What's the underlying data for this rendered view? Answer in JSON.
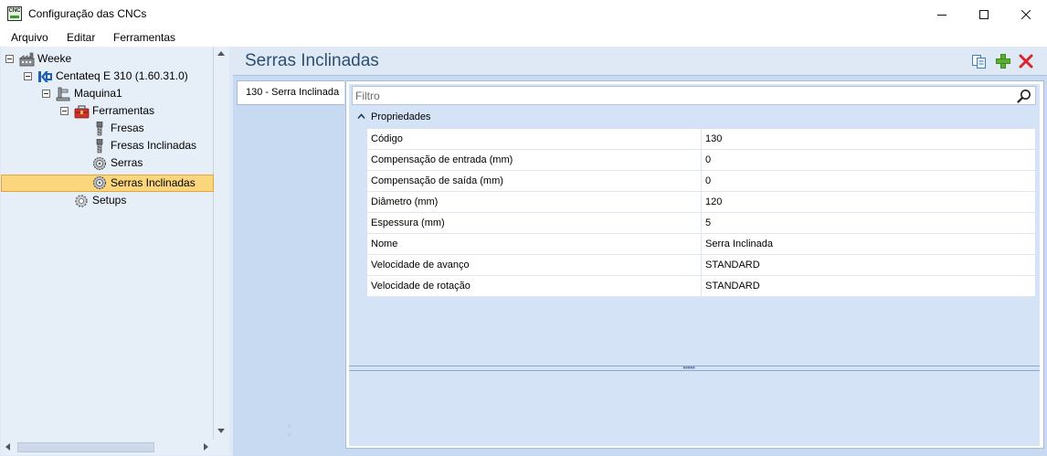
{
  "window": {
    "title": "Configuração das CNCs",
    "app_icon_text": "CNC",
    "controls": [
      "minimize",
      "maximize",
      "close"
    ]
  },
  "menu": {
    "items": [
      "Arquivo",
      "Editar",
      "Ferramentas"
    ]
  },
  "tree": {
    "nodes": [
      {
        "label": "Weeke",
        "icon": "factory-icon",
        "expanded": true
      },
      {
        "label": "Centateq E 310 (1.60.31.0)",
        "icon": "machine-logo-icon",
        "expanded": true
      },
      {
        "label": "Maquina1",
        "icon": "machine-icon",
        "expanded": true
      },
      {
        "label": "Ferramentas",
        "icon": "toolbox-icon",
        "expanded": true
      },
      {
        "label": "Fresas",
        "icon": "drill-bit-icon"
      },
      {
        "label": "Fresas Inclinadas",
        "icon": "drill-bit-icon"
      },
      {
        "label": "Serras",
        "icon": "saw-blade-icon"
      },
      {
        "label": "Serras Inclinadas",
        "icon": "saw-blade-icon",
        "selected": true
      },
      {
        "label": "Setups",
        "icon": "gear-icon"
      }
    ]
  },
  "header": {
    "title": "Serras Inclinadas",
    "toolbar": [
      "copy-icon",
      "add-icon",
      "delete-icon"
    ]
  },
  "list": {
    "items": [
      "130 - Serra Inclinada"
    ]
  },
  "filter": {
    "placeholder": "Filtro"
  },
  "properties": {
    "category": "Propriedades",
    "rows": [
      {
        "name": "Código",
        "value": "130"
      },
      {
        "name": "Compensação de entrada (mm)",
        "value": "0"
      },
      {
        "name": "Compensação de saída (mm)",
        "value": "0"
      },
      {
        "name": "Diâmetro (mm)",
        "value": "120"
      },
      {
        "name": "Espessura (mm)",
        "value": "5"
      },
      {
        "name": "Nome",
        "value": "Serra Inclinada"
      },
      {
        "name": "Velocidade de avanço",
        "value": "STANDARD"
      },
      {
        "name": "Velocidade de rotação",
        "value": "STANDARD"
      }
    ]
  },
  "colors": {
    "accent_title": "#2d4f72",
    "selection": "#fbd67c",
    "add_green": "#5bb030",
    "delete_red": "#d8262a"
  }
}
